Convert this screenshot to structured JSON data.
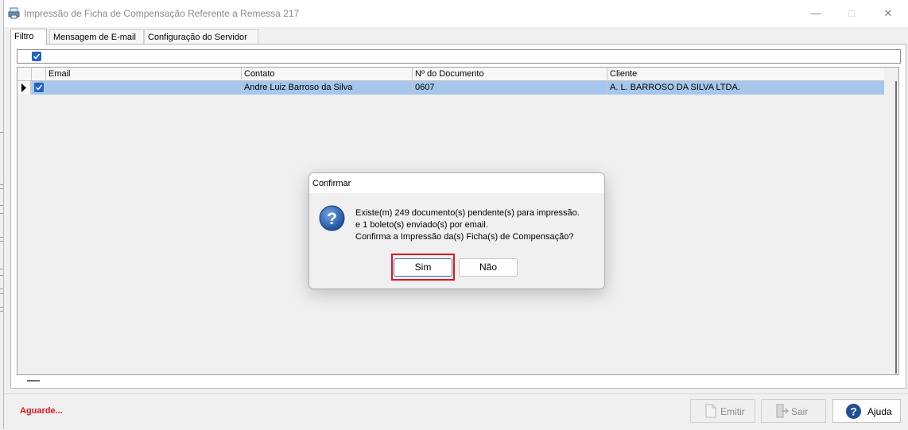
{
  "window": {
    "title": "Impressão de Ficha de Compensação Referente a Remessa 217"
  },
  "tabs": [
    {
      "label": "Filtro",
      "active": true
    },
    {
      "label": "Mensagem de E-mail",
      "active": false
    },
    {
      "label": "Configuração do Servidor",
      "active": false
    }
  ],
  "grid": {
    "columns": [
      "Email",
      "Contato",
      "Nº do Documento",
      "Cliente"
    ],
    "rows": [
      {
        "checked": true,
        "email": "",
        "contato": "Andre Luiz Barroso da Silva",
        "documento": "0607",
        "cliente": "A. L. BARROSO DA SILVA LTDA."
      }
    ]
  },
  "status": {
    "text": "Aguarde..."
  },
  "buttons": {
    "emitir": "Emitir",
    "sair": "Sair",
    "ajuda": "Ajuda"
  },
  "dialog": {
    "title": "Confirmar",
    "lines": [
      "Existe(m) 249 documento(s) pendente(s) para impressão.",
      "e 1 boleto(s) enviado(s) por email.",
      "Confirma a Impressão da(s) Ficha(s) de Compensação?"
    ],
    "yes_label": "Sim",
    "no_label": "Não"
  },
  "colors": {
    "accent": "#1d65c6",
    "selection": "#a7c6ec",
    "status_red": "#e0141c"
  },
  "icons": {
    "app": "printer-doc-icon",
    "question": "question-icon",
    "emitir": "document-icon",
    "sair": "exit-door-icon",
    "ajuda": "help-icon"
  }
}
